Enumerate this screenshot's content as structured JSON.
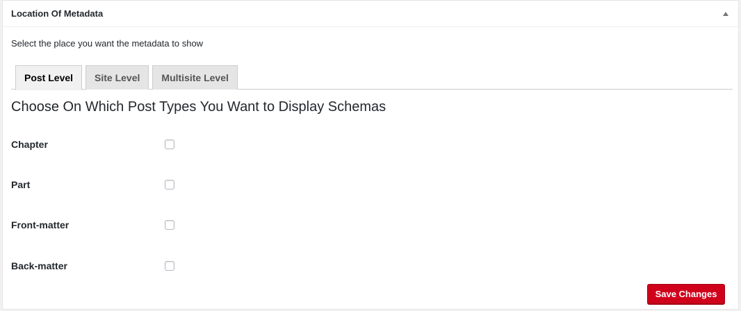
{
  "panel": {
    "title": "Location Of Metadata"
  },
  "description": "Select the place you want the metadata to show",
  "tabs": [
    {
      "label": "Post Level",
      "active": true
    },
    {
      "label": "Site Level",
      "active": false
    },
    {
      "label": "Multisite Level",
      "active": false
    }
  ],
  "section": {
    "heading": "Choose On Which Post Types You Want to Display Schemas"
  },
  "post_types": [
    {
      "label": "Chapter",
      "checked": false
    },
    {
      "label": "Part",
      "checked": false
    },
    {
      "label": "Front-matter",
      "checked": false
    },
    {
      "label": "Back-matter",
      "checked": false
    }
  ],
  "actions": {
    "save_label": "Save Changes"
  },
  "colors": {
    "accent": "#d0021b"
  }
}
